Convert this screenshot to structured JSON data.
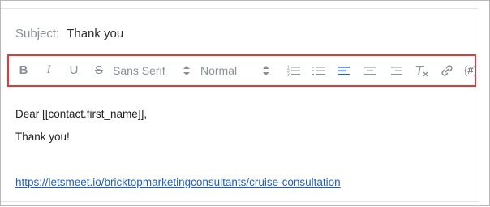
{
  "subject": {
    "label": "Subject:",
    "value": "Thank you"
  },
  "toolbar": {
    "bold_label": "B",
    "italic_label": "I",
    "underline_label": "U",
    "strike_label": "S",
    "font_select_value": "Sans Serif",
    "size_select_value": "Normal",
    "merge_tag_label": "{#}",
    "icons": [
      "bold-icon",
      "italic-icon",
      "underline-icon",
      "strikethrough-icon",
      "ordered-list-icon",
      "bullet-list-icon",
      "align-left-icon",
      "align-center-icon",
      "align-right-icon",
      "clear-format-icon",
      "link-icon",
      "merge-tag-icon"
    ],
    "active_color": "#1a5fc7",
    "highlight_border_color": "#e03b3b"
  },
  "editor": {
    "line1": "Dear [[contact.first_name]],",
    "line2": "Thank you!",
    "link_text": "https://letsmeet.io/bricktopmarketingconsultants/cruise-consultation"
  }
}
